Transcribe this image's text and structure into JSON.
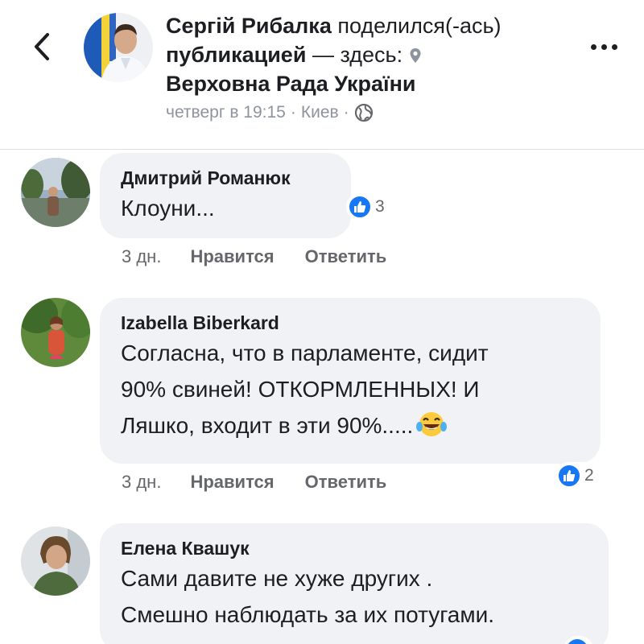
{
  "post": {
    "author": "Сергій Рибалка",
    "shared_text": "поделился(-ась)",
    "publication_word": "публикацией",
    "here_text": "— здесь:",
    "place": "Верховна Рада України",
    "time": "четверг в 19:15",
    "separator": "·",
    "city": "Киев"
  },
  "comments": [
    {
      "name": "Дмитрий Романюк",
      "lines": [
        "Клоуни..."
      ],
      "time": "3 дн.",
      "like_label": "Нравится",
      "reply_label": "Ответить",
      "reaction_count": "3"
    },
    {
      "name": "Izabella Biberkard",
      "lines": [
        "Согласна, что в парламенте, сидит",
        "90% свиней! ОТКОРМЛЕННЫХ! И",
        "Ляшко, входит в эти 90%....."
      ],
      "emoji": "laughing-with-tears",
      "time": "3 дн.",
      "like_label": "Нравится",
      "reply_label": "Ответить",
      "reaction_count": "2"
    },
    {
      "name": "Елена Квашук",
      "lines": [
        "Сами давите не хуже других .",
        "Смешно наблюдать за их потугами."
      ]
    }
  ],
  "icons": {
    "back": "chevron-left-icon",
    "more": "more-dots-icon",
    "location": "location-pin-icon",
    "privacy": "globe-icon",
    "like_reaction": "thumbs-up-icon"
  },
  "colors": {
    "like_blue": "#1877f2",
    "bubble_bg": "#f0f2f5",
    "meta_gray": "#8d949e",
    "action_gray": "#65676b"
  }
}
